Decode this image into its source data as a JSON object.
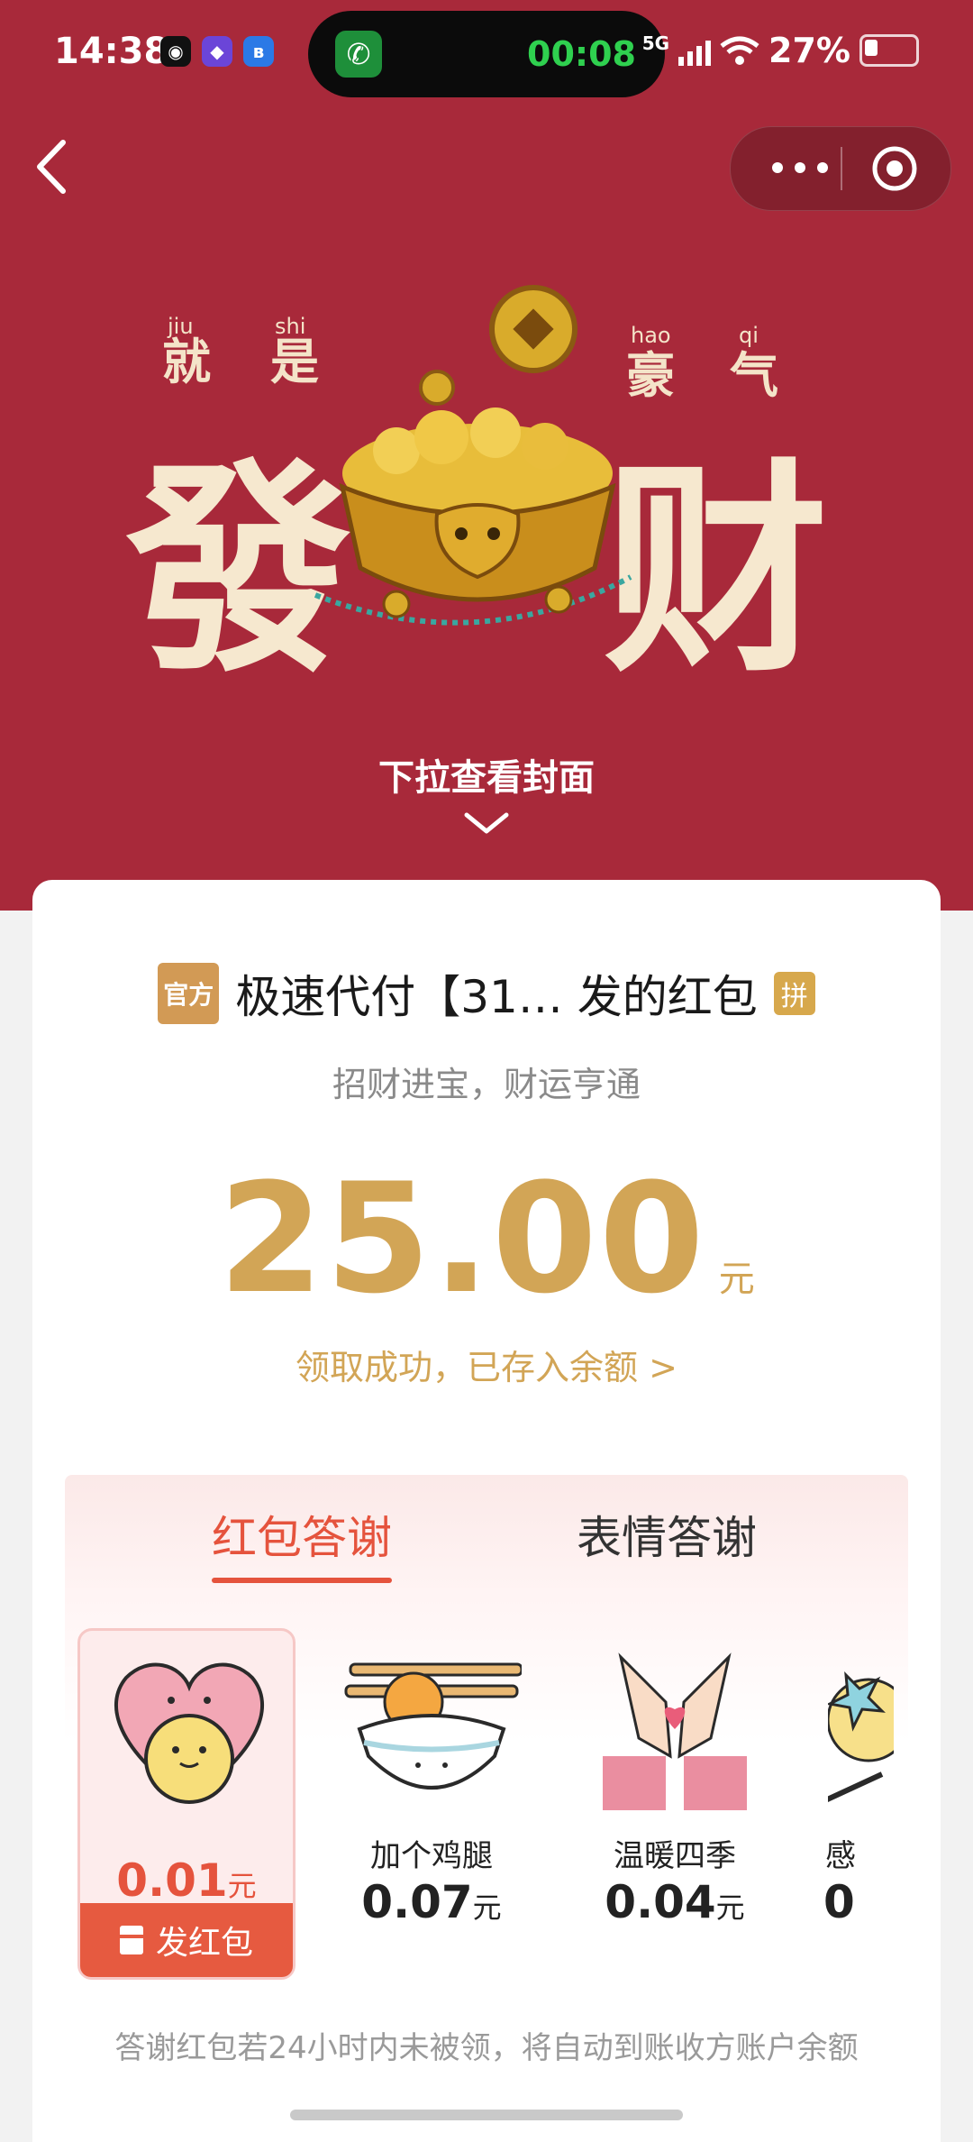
{
  "status_bar": {
    "time": "14:38",
    "call_timer": "00:08",
    "network": "5G",
    "battery": "27%"
  },
  "hero": {
    "pinyin": [
      "jiu",
      "shi",
      "hao",
      "qi"
    ],
    "small_chars": [
      "就",
      "是",
      "豪",
      "气"
    ],
    "big_chars": [
      "發",
      "财"
    ],
    "pull_hint": "下拉查看封面"
  },
  "envelope": {
    "official_badge": "官方",
    "sender": "极速代付【31… 发的红包",
    "pin_badge": "拼",
    "blessing": "招财进宝，财运亨通",
    "amount": "25.00",
    "unit": "元",
    "status": "领取成功，已存入余额 >"
  },
  "thanks": {
    "tabs": [
      "红包答谢",
      "表情答谢"
    ],
    "selected_gift": {
      "price": "0.01",
      "unit": "元",
      "button": "发红包"
    },
    "gifts": [
      {
        "name": "加个鸡腿",
        "price": "0.07",
        "unit": "元"
      },
      {
        "name": "温暖四季",
        "price": "0.04",
        "unit": "元"
      },
      {
        "name": "感",
        "price": "0",
        "unit": ""
      }
    ],
    "footnote": "答谢红包若24小时内未被领，将自动到账收方账户余额"
  },
  "colors": {
    "header_red": "#a8293a",
    "gold": "#d2a556",
    "accent_red": "#e5533d"
  }
}
